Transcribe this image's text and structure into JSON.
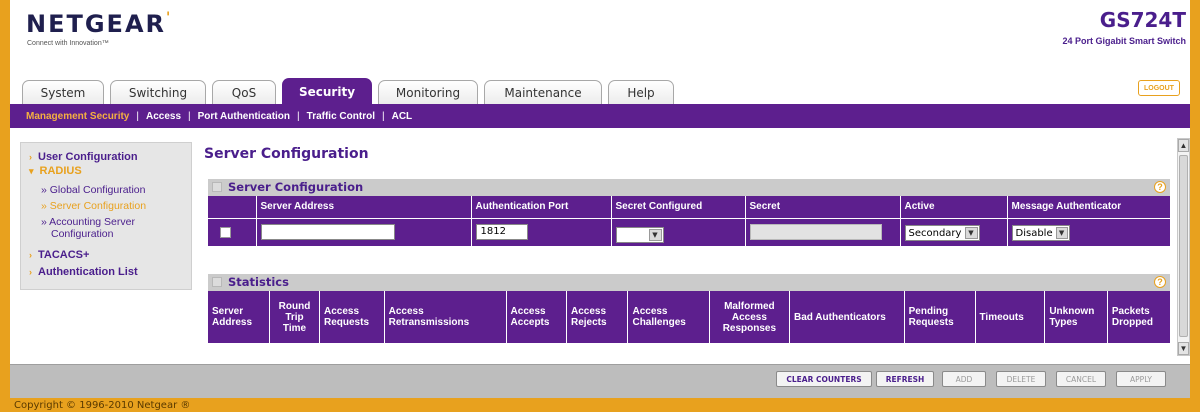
{
  "header": {
    "logo": "NETGEAR",
    "tagline": "Connect with Innovation™",
    "model": "GS724T",
    "model_desc": "24 Port Gigabit Smart Switch",
    "logout_label": "LOGOUT"
  },
  "tabs": [
    {
      "label": "System"
    },
    {
      "label": "Switching"
    },
    {
      "label": "QoS"
    },
    {
      "label": "Security",
      "active": true
    },
    {
      "label": "Monitoring"
    },
    {
      "label": "Maintenance"
    },
    {
      "label": "Help"
    }
  ],
  "subnav": [
    {
      "label": "Management Security",
      "active": true
    },
    {
      "label": "Access"
    },
    {
      "label": "Port Authentication"
    },
    {
      "label": "Traffic Control"
    },
    {
      "label": "ACL"
    }
  ],
  "leftnav": {
    "user_configuration": "User Configuration",
    "radius": "RADIUS",
    "global_configuration": "» Global Configuration",
    "server_configuration": "» Server Configuration",
    "accounting_server": "» Accounting Server",
    "accounting_server_2": "Configuration",
    "tacacs": "TACACS+",
    "authentication_list": "Authentication List"
  },
  "page_title": "Server Configuration",
  "server_config": {
    "section_title": "Server Configuration",
    "columns": [
      "",
      "Server Address",
      "Authentication Port",
      "Secret Configured",
      "Secret",
      "Active",
      "Message Authenticator"
    ],
    "row": {
      "server_address": "",
      "authentication_port": "1812",
      "secret_configured": "",
      "secret": "",
      "active": "Secondary",
      "message_authenticator": "Disable"
    }
  },
  "statistics": {
    "section_title": "Statistics",
    "columns": [
      "Server Address",
      "Round Trip Time",
      "Access Requests",
      "Access Retransmissions",
      "Access Accepts",
      "Access Rejects",
      "Access Challenges",
      "Malformed Access Responses",
      "Bad Authenticators",
      "Pending Requests",
      "Timeouts",
      "Unknown Types",
      "Packets Dropped"
    ]
  },
  "buttons": {
    "clear_counters": "CLEAR COUNTERS",
    "refresh": "REFRESH",
    "add": "ADD",
    "delete": "DELETE",
    "cancel": "CANCEL",
    "apply": "APPLY"
  },
  "footer": {
    "copyright": "Copyright © 1996-2010 Netgear ®"
  },
  "colors": {
    "purple": "#5d1f8e",
    "orange": "#e8a11e",
    "gray_bar": "#bdbdbd"
  },
  "icons": {
    "help": "help-icon",
    "dropdown": "chevron-down-icon",
    "scroll_up": "arrow-up-icon",
    "scroll_down": "arrow-down-icon",
    "nav_arrow": "chevron-right-icon"
  }
}
